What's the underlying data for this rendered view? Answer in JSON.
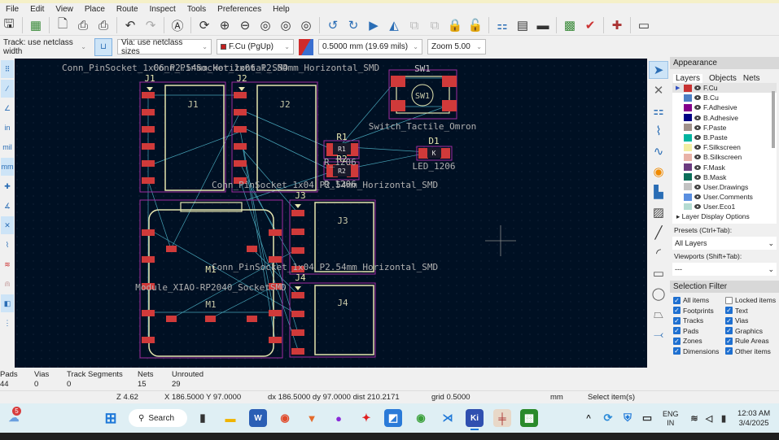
{
  "menu": [
    "File",
    "Edit",
    "View",
    "Place",
    "Route",
    "Inspect",
    "Tools",
    "Preferences",
    "Help"
  ],
  "toolbar": {
    "icons": [
      "save-icon",
      "board-setup-icon",
      "page-settings-icon",
      "print-icon",
      "plot-icon",
      "undo-icon",
      "redo-icon",
      "find-icon",
      "refresh-icon",
      "zoom-in-icon",
      "zoom-out-icon",
      "zoom-fit-icon",
      "zoom-objects-icon",
      "zoom-selection-icon",
      "rotate-ccw-icon",
      "rotate-cw-icon",
      "flip-icon",
      "mirror-icon",
      "group-icon",
      "ungroup-icon",
      "lock-icon",
      "unlock-icon",
      "update-pcb-icon",
      "footprint-editor-icon",
      "footprint-browser-icon",
      "scripting-icon",
      "drc-icon",
      "board-3d-icon",
      "python-console-icon"
    ]
  },
  "toolbar2": {
    "track_width": "Track: use netclass width",
    "via_size": "Via: use netclass sizes",
    "layer": "F.Cu (PgUp)",
    "grid": "0.5000 mm (19.69 mils)",
    "zoom": "Zoom 5.00"
  },
  "canvas": {
    "texts": {
      "conn6_a": "Conn_PinSocket_1x06_P2.54mm_Horizontal_SMD",
      "conn6_b": "Conn_PinSocket_1x06_P2.54mm_Horizontal_SMD",
      "r1206_top": "R_1206",
      "conn4_j3": "Conn_PinSocket_1x04_P2.54mm_Horizontal_SMD",
      "conn4_j4": "Conn_PinSocket_1x04_P2.54mm_Horizontal_SMD",
      "r1206_bottom": "R_1206",
      "j1": "J1",
      "j2": "J2",
      "j3": "J3",
      "j4": "J4",
      "sw1": "SW1",
      "sw1_value": "Switch_Tactile_Omron",
      "r1": "R1",
      "r2": "R2",
      "d1": "D1",
      "d1_value": "LED_1206",
      "d1_pad": "K",
      "m1": "M1",
      "m1_value": "Module_XIAO-RP2040_SocketSMD"
    },
    "colors": {
      "background": "#001023",
      "pad": "#d03a3a",
      "courtyard": "#a02ca0",
      "silkscreen": "#e6e6b0",
      "ratsnest": "#46a2b6"
    }
  },
  "appearance": {
    "title": "Appearance",
    "tabs": [
      "Layers",
      "Objects",
      "Nets"
    ],
    "layers": [
      {
        "name": "F.Cu",
        "color": "#c83232"
      },
      {
        "name": "B.Cu",
        "color": "#4d7fc4"
      },
      {
        "name": "F.Adhesive",
        "color": "#84008a"
      },
      {
        "name": "B.Adhesive",
        "color": "#000084"
      },
      {
        "name": "F.Paste",
        "color": "#a0918a"
      },
      {
        "name": "B.Paste",
        "color": "#00b4a0"
      },
      {
        "name": "F.Silkscreen",
        "color": "#f2eda1"
      },
      {
        "name": "B.Silkscreen",
        "color": "#e8b2a7"
      },
      {
        "name": "F.Mask",
        "color": "#6b3b7f"
      },
      {
        "name": "B.Mask",
        "color": "#0b6e5a"
      },
      {
        "name": "User.Drawings",
        "color": "#c2c2c2"
      },
      {
        "name": "User.Comments",
        "color": "#5a8fe0"
      },
      {
        "name": "User.Eco1",
        "color": "#b4dbd2"
      }
    ],
    "layer_display_options": "Layer Display Options",
    "presets_label": "Presets (Ctrl+Tab):",
    "presets_value": "All Layers",
    "viewports_label": "Viewports (Shift+Tab):",
    "viewports_value": "---"
  },
  "selection_filter": {
    "title": "Selection Filter",
    "items": [
      {
        "label": "All items",
        "checked": true
      },
      {
        "label": "Locked items",
        "checked": false
      },
      {
        "label": "Footprints",
        "checked": true
      },
      {
        "label": "Text",
        "checked": true
      },
      {
        "label": "Tracks",
        "checked": true
      },
      {
        "label": "Vias",
        "checked": true
      },
      {
        "label": "Pads",
        "checked": true
      },
      {
        "label": "Graphics",
        "checked": true
      },
      {
        "label": "Zones",
        "checked": true
      },
      {
        "label": "Rule Areas",
        "checked": true
      },
      {
        "label": "Dimensions",
        "checked": true
      },
      {
        "label": "Other items",
        "checked": true
      }
    ]
  },
  "messages": [
    {
      "label": "Pads",
      "value": "44"
    },
    {
      "label": "Vias",
      "value": "0"
    },
    {
      "label": "Track Segments",
      "value": "0"
    },
    {
      "label": "Nets",
      "value": "15"
    },
    {
      "label": "Unrouted",
      "value": "29"
    }
  ],
  "status": {
    "z": "Z 4.62",
    "xy": "X 186.5000  Y 97.0000",
    "delta": "dx 186.5000  dy 97.0000  dist 210.2171",
    "grid": "grid 0.5000",
    "units": "mm",
    "mode": "Select item(s)"
  },
  "taskbar": {
    "search": "Search",
    "weather_badge": "5",
    "lang1": "ENG",
    "lang2": "IN",
    "time": "12:03 AM",
    "date": "3/4/2025"
  }
}
